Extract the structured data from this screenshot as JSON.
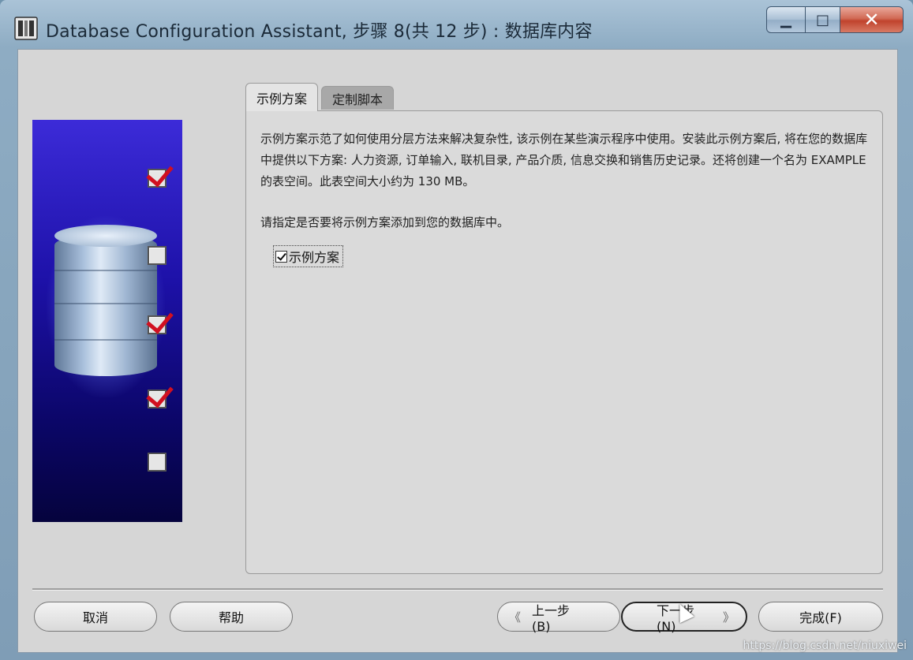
{
  "window": {
    "title": "Database Configuration Assistant, 步骤 8(共 12 步) : 数据库内容",
    "controls": {
      "minimize": "▁",
      "maximize": "□",
      "close": "✕"
    }
  },
  "side_panel": {
    "steps": [
      {
        "checked": true
      },
      {
        "checked": false
      },
      {
        "checked": true
      },
      {
        "checked": true
      },
      {
        "checked": false
      }
    ]
  },
  "tabs": [
    {
      "label": "示例方案",
      "active": true
    },
    {
      "label": "定制脚本",
      "active": false
    }
  ],
  "content": {
    "description": "示例方案示范了如何使用分层方法来解决复杂性, 该示例在某些演示程序中使用。安装此示例方案后, 将在您的数据库中提供以下方案: 人力资源, 订单输入, 联机目录, 产品介质, 信息交换和销售历史记录。还将创建一个名为 EXAMPLE 的表空间。此表空间大小约为 130 MB。",
    "prompt": "请指定是否要将示例方案添加到您的数据库中。",
    "checkbox": {
      "label": "示例方案",
      "checked": true
    }
  },
  "buttons": {
    "cancel": "取消",
    "help": "帮助",
    "back": "上一步(B)",
    "next": "下一步(N)",
    "finish": "完成(F)",
    "back_arrow": "《",
    "next_arrow": "》"
  },
  "watermark": "https://blog.csdn.net/niuxiwei"
}
